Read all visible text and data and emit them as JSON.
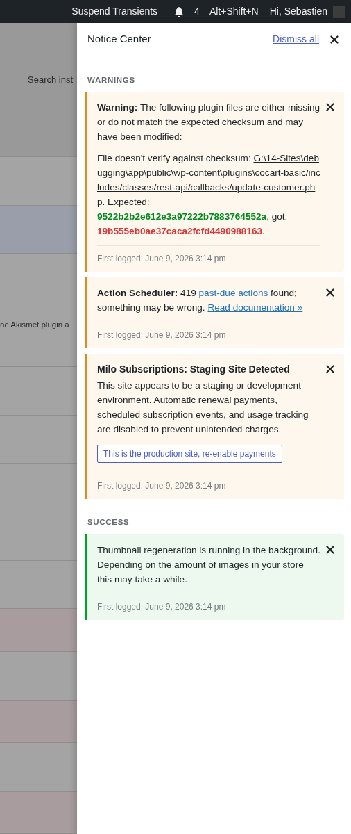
{
  "admin_bar": {
    "items": [
      {
        "kind": "text",
        "label": "Suspend Transients"
      },
      {
        "kind": "notifications",
        "label": "4"
      },
      {
        "kind": "text",
        "label": "Alt+Shift+N"
      },
      {
        "kind": "account",
        "label": "Hi, Sebastien"
      }
    ]
  },
  "background": {
    "search_label": "Search inst",
    "rows": [
      {
        "kind": "header"
      },
      {
        "kind": "plain"
      },
      {
        "kind": "highlight"
      },
      {
        "kind": "plain"
      },
      {
        "kind": "plain",
        "text": "ne Akismet plugin a"
      },
      {
        "kind": "plain"
      },
      {
        "kind": "plain"
      },
      {
        "kind": "plain"
      },
      {
        "kind": "plain"
      },
      {
        "kind": "plain"
      },
      {
        "kind": "error"
      },
      {
        "kind": "plain"
      },
      {
        "kind": "error"
      },
      {
        "kind": "plain"
      },
      {
        "kind": "error"
      }
    ]
  },
  "notice_center": {
    "title": "Notice Center",
    "dismiss_all": "Dismiss all",
    "sections": [
      {
        "heading": "WARNINGS",
        "notices": [
          {
            "kind": "warning",
            "paragraphs": [
              [
                {
                  "kind": "bold",
                  "text": "Warning:"
                },
                {
                  "kind": "text",
                  "text": " The following plugin files are either missing or do not match the expected checksum and may have been modified:"
                }
              ],
              [
                {
                  "kind": "text",
                  "text": "File doesn't verify against checksum: "
                },
                {
                  "kind": "path",
                  "text": "G:\\14-Sites\\debugging\\app\\public\\wp-content\\plugins\\cocart-basic/includes/classes/rest-api/callbacks/update-customer.php"
                },
                {
                  "kind": "text",
                  "text": ". Expected: "
                },
                {
                  "kind": "expected",
                  "text": "9522b2b2e612e3a97222b7883764552a"
                },
                {
                  "kind": "text",
                  "text": ", got: "
                },
                {
                  "kind": "actual",
                  "text": "19b555eb0ae37caca2fcfd4490988163"
                },
                {
                  "kind": "text",
                  "text": "."
                }
              ]
            ],
            "logged": "First logged: June 9, 2026 3:14 pm"
          },
          {
            "kind": "warning",
            "paragraphs": [
              [
                {
                  "kind": "bold",
                  "text": "Action Scheduler:"
                },
                {
                  "kind": "text",
                  "text": " 419 "
                },
                {
                  "kind": "link",
                  "text": "past-due actions"
                },
                {
                  "kind": "text",
                  "text": " found; something may be wrong. "
                },
                {
                  "kind": "link",
                  "text": "Read documentation »"
                }
              ]
            ],
            "logged": "First logged: June 9, 2026 3:14 pm"
          },
          {
            "kind": "warning",
            "title": "Milo Subscriptions: Staging Site Detected",
            "paragraphs": [
              [
                {
                  "kind": "text",
                  "text": "This site appears to be a staging or development environment. Automatic renewal payments, scheduled subscription events, and usage tracking are disabled to prevent unintended charges."
                }
              ]
            ],
            "action": "This is the production site, re-enable payments",
            "logged": "First logged: June 9, 2026 3:14 pm"
          }
        ]
      },
      {
        "heading": "SUCCESS",
        "notices": [
          {
            "kind": "success",
            "paragraphs": [
              [
                {
                  "kind": "text",
                  "text": "Thumbnail regeneration is running in the background. Depending on the amount of images in your store this may take a while."
                }
              ]
            ],
            "logged": "First logged: June 9, 2026 3:14 pm"
          }
        ]
      }
    ]
  }
}
